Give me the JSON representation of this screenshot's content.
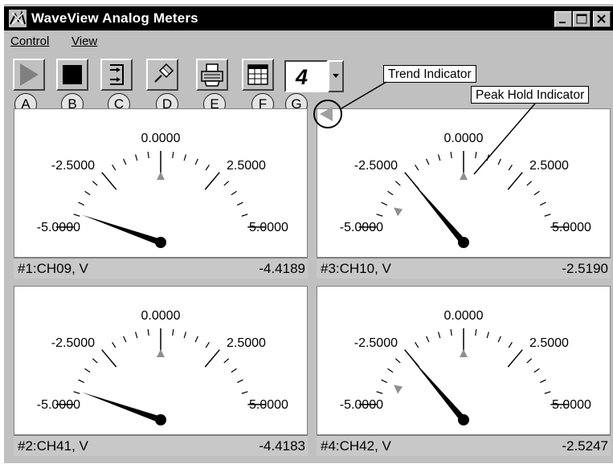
{
  "window": {
    "title": "WaveView Analog Meters"
  },
  "menu": {
    "items": [
      {
        "label": "Control"
      },
      {
        "label": "View"
      }
    ]
  },
  "toolbar": {
    "buttons": [
      {
        "letter": "A",
        "icon": "play-icon"
      },
      {
        "letter": "B",
        "icon": "stop-icon"
      },
      {
        "letter": "C",
        "icon": "channel-select-icon"
      },
      {
        "letter": "D",
        "icon": "pin-icon"
      },
      {
        "letter": "E",
        "icon": "print-icon"
      },
      {
        "letter": "F",
        "icon": "table-icon"
      },
      {
        "letter": "G",
        "icon": "meter-count-dropdown"
      }
    ],
    "meter_count": "4"
  },
  "callouts": {
    "trend": "Trend Indicator",
    "peak": "Peak Hold Indicator"
  },
  "meters": [
    {
      "label": "#1:CH09, V",
      "value": "-4.4189",
      "tick_min": "-5.0000",
      "tick_mid_low": "-2.5000",
      "tick_zero": "0.0000",
      "tick_mid_high": "2.5000",
      "tick_max": "5.0000",
      "needle": -4.4189,
      "peak": 0.0
    },
    {
      "label": "#3:CH10, V",
      "value": "-2.5190",
      "tick_min": "-5.0000",
      "tick_mid_low": "-2.5000",
      "tick_zero": "0.0000",
      "tick_mid_high": "2.5000",
      "tick_max": "5.0000",
      "needle": -2.519,
      "peak": 0.0,
      "trend": -4.0
    },
    {
      "label": "#2:CH41, V",
      "value": "-4.4183",
      "tick_min": "-5.0000",
      "tick_mid_low": "-2.5000",
      "tick_zero": "0.0000",
      "tick_mid_high": "2.5000",
      "tick_max": "5.0000",
      "needle": -4.4183,
      "peak": 0.0
    },
    {
      "label": "#4:CH42, V",
      "value": "-2.5247",
      "tick_min": "-5.0000",
      "tick_mid_low": "-2.5000",
      "tick_zero": "0.0000",
      "tick_mid_high": "2.5000",
      "tick_max": "5.0000",
      "needle": -2.5247,
      "peak": 0.0,
      "trend": -4.0
    }
  ]
}
